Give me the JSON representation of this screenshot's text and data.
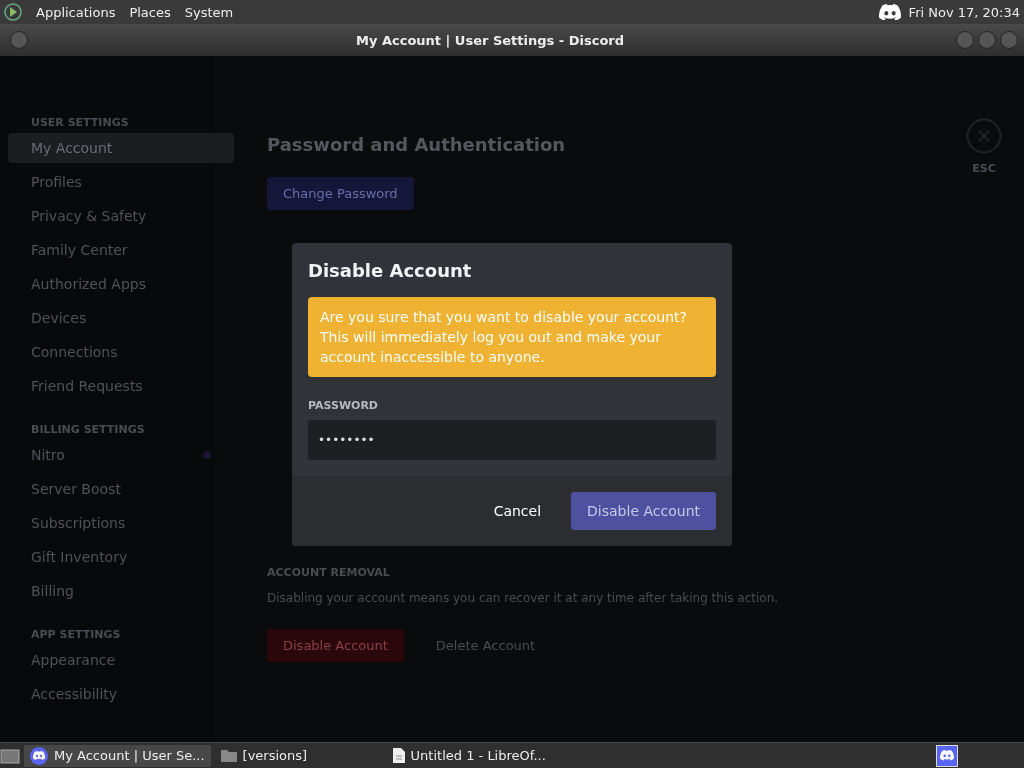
{
  "top_panel": {
    "menus": [
      "Applications",
      "Places",
      "System"
    ],
    "clock": "Fri Nov 17, 20:34"
  },
  "window": {
    "title": "My Account | User Settings - Discord"
  },
  "sidebar": {
    "sections": [
      {
        "header": "USER SETTINGS",
        "items": [
          {
            "label": "My Account",
            "selected": true
          },
          {
            "label": "Profiles",
            "selected": false
          },
          {
            "label": "Privacy & Safety",
            "selected": false
          },
          {
            "label": "Family Center",
            "selected": false
          },
          {
            "label": "Authorized Apps",
            "selected": false
          },
          {
            "label": "Devices",
            "selected": false
          },
          {
            "label": "Connections",
            "selected": false
          },
          {
            "label": "Friend Requests",
            "selected": false
          }
        ]
      },
      {
        "header": "BILLING SETTINGS",
        "items": [
          {
            "label": "Nitro",
            "selected": false,
            "badge": true
          },
          {
            "label": "Server Boost",
            "selected": false
          },
          {
            "label": "Subscriptions",
            "selected": false
          },
          {
            "label": "Gift Inventory",
            "selected": false
          },
          {
            "label": "Billing",
            "selected": false
          }
        ]
      },
      {
        "header": "APP SETTINGS",
        "items": [
          {
            "label": "Appearance",
            "selected": false
          },
          {
            "label": "Accessibility",
            "selected": false
          }
        ]
      }
    ]
  },
  "content": {
    "heading": "Password and Authentication",
    "change_password": "Change Password",
    "removal_header": "ACCOUNT REMOVAL",
    "removal_text": "Disabling your account means you can recover it at any time after taking this action.",
    "disable_button": "Disable Account",
    "delete_button": "Delete Account",
    "close_label": "ESC"
  },
  "dialog": {
    "title": "Disable Account",
    "warning": "Are you sure that you want to disable your account? This will immediately log you out and make your account inaccessible to anyone.",
    "field_label": "PASSWORD",
    "password": "••••••••",
    "cancel": "Cancel",
    "confirm": "Disable Account"
  },
  "taskbar": {
    "tasks": [
      {
        "label": "My Account | User Se...",
        "kind": "discord",
        "selected": true
      },
      {
        "label": "[versions]",
        "kind": "folder",
        "selected": false
      },
      {
        "label": "Untitled 1 - LibreOf...",
        "kind": "document",
        "selected": false
      }
    ]
  }
}
